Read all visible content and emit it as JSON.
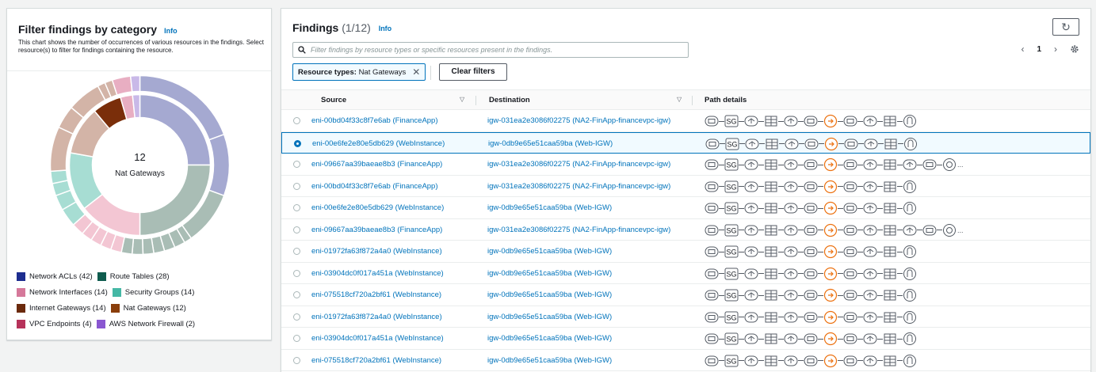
{
  "filter_panel": {
    "title": "Filter findings by category",
    "info": "Info",
    "description": "This chart shows the number of occurrences of various resources in the findings. Select resource(s) to filter for findings containing the resource.",
    "center_count": "12",
    "center_label": "Nat Gateways",
    "legend": [
      {
        "label": "Network ACLs (42)",
        "color": "#1d2d8f"
      },
      {
        "label": "Route Tables (28)",
        "color": "#0f5c4e"
      },
      {
        "label": "Network Interfaces (14)",
        "color": "#d5789a"
      },
      {
        "label": "Security Groups (14)",
        "color": "#45b8a5"
      },
      {
        "label": "Internet Gateways (14)",
        "color": "#6b2a0c"
      },
      {
        "label": "Nat Gateways (12)",
        "color": "#8a3e0b"
      },
      {
        "label": "VPC Endpoints (4)",
        "color": "#b6325a"
      },
      {
        "label": "AWS Network Firewall (2)",
        "color": "#8a57d1"
      }
    ]
  },
  "findings": {
    "title": "Findings",
    "count": "(1/12)",
    "info": "Info",
    "search_placeholder": "Filter findings by resource types or specific resources present in the findings.",
    "token": {
      "key": "Resource types:",
      "value": "Nat Gateways"
    },
    "clear_filters": "Clear filters",
    "page": "1",
    "columns": {
      "source": "Source",
      "destination": "Destination",
      "path": "Path details"
    },
    "rows": [
      {
        "source": "eni-00bd04f33c8f7e6ab (FinanceApp)",
        "destination": "igw-031ea2e3086f02275 (NA2-FinApp-financevpc-igw)",
        "selected": false,
        "long": false
      },
      {
        "source": "eni-00e6fe2e80e5db629 (WebInstance)",
        "destination": "igw-0db9e65e51caa59ba (Web-IGW)",
        "selected": true,
        "long": false
      },
      {
        "source": "eni-09667aa39baeae8b3 (FinanceApp)",
        "destination": "igw-031ea2e3086f02275 (NA2-FinApp-financevpc-igw)",
        "selected": false,
        "long": true
      },
      {
        "source": "eni-00bd04f33c8f7e6ab (FinanceApp)",
        "destination": "igw-031ea2e3086f02275 (NA2-FinApp-financevpc-igw)",
        "selected": false,
        "long": false
      },
      {
        "source": "eni-00e6fe2e80e5db629 (WebInstance)",
        "destination": "igw-0db9e65e51caa59ba (Web-IGW)",
        "selected": false,
        "long": false
      },
      {
        "source": "eni-09667aa39baeae8b3 (FinanceApp)",
        "destination": "igw-031ea2e3086f02275 (NA2-FinApp-financevpc-igw)",
        "selected": false,
        "long": true
      },
      {
        "source": "eni-01972fa63f872a4a0 (WebInstance)",
        "destination": "igw-0db9e65e51caa59ba (Web-IGW)",
        "selected": false,
        "long": false
      },
      {
        "source": "eni-03904dc0f017a451a (WebInstance)",
        "destination": "igw-0db9e65e51caa59ba (Web-IGW)",
        "selected": false,
        "long": false
      },
      {
        "source": "eni-075518cf720a2bf61 (WebInstance)",
        "destination": "igw-0db9e65e51caa59ba (Web-IGW)",
        "selected": false,
        "long": false
      },
      {
        "source": "eni-01972fa63f872a4a0 (WebInstance)",
        "destination": "igw-0db9e65e51caa59ba (Web-IGW)",
        "selected": false,
        "long": false
      },
      {
        "source": "eni-03904dc0f017a451a (WebInstance)",
        "destination": "igw-0db9e65e51caa59ba (Web-IGW)",
        "selected": false,
        "long": false
      },
      {
        "source": "eni-075518cf720a2bf61 (WebInstance)",
        "destination": "igw-0db9e65e51caa59ba (Web-IGW)",
        "selected": false,
        "long": false
      }
    ],
    "path_icons": [
      "eni-icon",
      "security-group-icon",
      "network-acl-icon",
      "route-table-icon",
      "network-acl-icon",
      "eni-icon",
      "nat-gateway-icon",
      "eni-icon",
      "network-acl-icon",
      "route-table-icon",
      "internet-gateway-icon"
    ],
    "path_icons_long": [
      "eni-icon",
      "security-group-icon",
      "network-acl-icon",
      "route-table-icon",
      "network-acl-icon",
      "eni-icon",
      "nat-gateway-icon",
      "eni-icon",
      "network-acl-icon",
      "route-table-icon",
      "network-acl-icon",
      "eni-icon",
      "vpc-endpoint-icon"
    ],
    "sg_text": "SG",
    "more_text": "..."
  },
  "colors": {
    "link": "#0073bb",
    "nat_icon": "#ec7211",
    "icon": "#545b64"
  }
}
